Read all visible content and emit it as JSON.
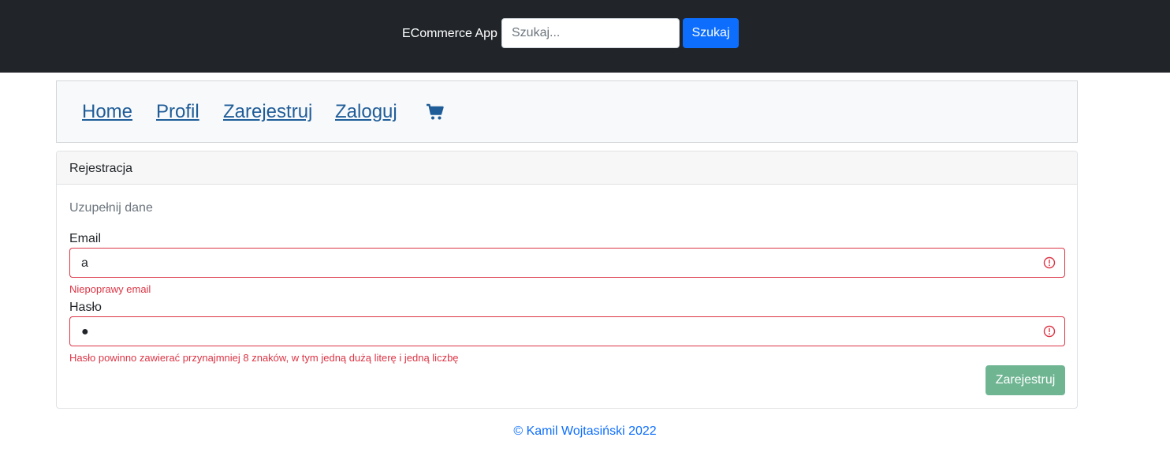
{
  "header": {
    "brand": "ECommerce App",
    "search": {
      "placeholder": "Szukaj...",
      "value": ""
    },
    "search_button": "Szukaj",
    "colors": {
      "background": "#212529",
      "button": "#0d6efd"
    }
  },
  "nav": {
    "items": [
      {
        "label": "Home"
      },
      {
        "label": "Profil"
      },
      {
        "label": "Zarejestruj"
      },
      {
        "label": "Zaloguj"
      }
    ],
    "cart_icon": "shopping-cart-icon",
    "link_color": "#1f5d99"
  },
  "form": {
    "title": "Rejestracja",
    "subtitle": "Uzupełnij dane",
    "fields": [
      {
        "label": "Email",
        "value": "a",
        "error": "Niepoprawy email",
        "state": "invalid",
        "icon": "alert-circle-icon"
      },
      {
        "label": "Hasło",
        "value": "●",
        "error": "Hasło powinno zawierać przynajmniej 8 znaków, w tym jedną dużą literę i jedną liczbę",
        "state": "invalid",
        "icon": "alert-circle-icon"
      }
    ],
    "submit": "Zarejestruj",
    "colors": {
      "error": "#dc3545",
      "submit": "#6fb592"
    }
  },
  "footer": {
    "text": "© Kamil Wojtasiński 2022"
  }
}
